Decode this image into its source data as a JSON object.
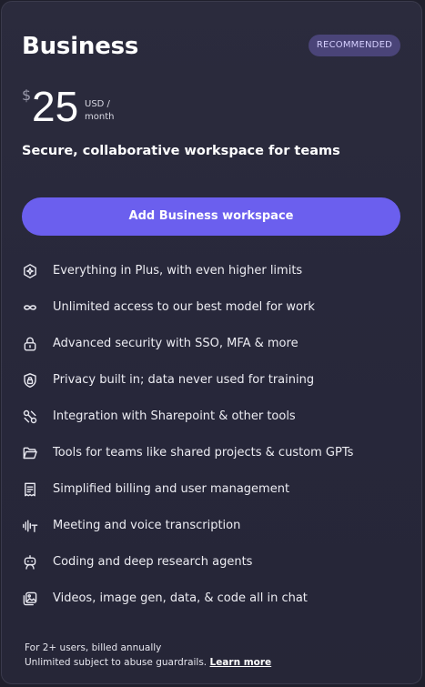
{
  "plan": {
    "title": "Business",
    "badge": "RECOMMENDED",
    "currency_symbol": "$",
    "price": "25",
    "period_line1": "USD /",
    "period_line2": "month",
    "tagline": "Secure, collaborative workspace for teams",
    "cta_label": "Add Business workspace"
  },
  "features": [
    {
      "label": "Everything in Plus, with even higher limits",
      "icon": "sparkle-shield-icon"
    },
    {
      "label": "Unlimited access to our best model for work",
      "icon": "infinity-icon"
    },
    {
      "label": "Advanced security with SSO, MFA & more",
      "icon": "lock-icon"
    },
    {
      "label": "Privacy built in; data never used for training",
      "icon": "shield-lock-icon"
    },
    {
      "label": "Integration with Sharepoint & other tools",
      "icon": "link-icon"
    },
    {
      "label": "Tools for teams like shared projects & custom GPTs",
      "icon": "folder-icon"
    },
    {
      "label": "Simplified billing and user management",
      "icon": "receipt-icon"
    },
    {
      "label": "Meeting and voice transcription",
      "icon": "transcription-icon"
    },
    {
      "label": "Coding and deep research agents",
      "icon": "robot-icon"
    },
    {
      "label": "Videos, image gen, data, & code all in chat",
      "icon": "media-icon"
    }
  ],
  "footer": {
    "line1": "For 2+ users, billed annually",
    "line2": "Unlimited subject to abuse guardrails.",
    "learn_more": "Learn more"
  },
  "colors": {
    "background": "#2b2b3d",
    "accent": "#6b5fee",
    "badge_bg": "#4a4478",
    "badge_text": "#d6d0ff"
  }
}
